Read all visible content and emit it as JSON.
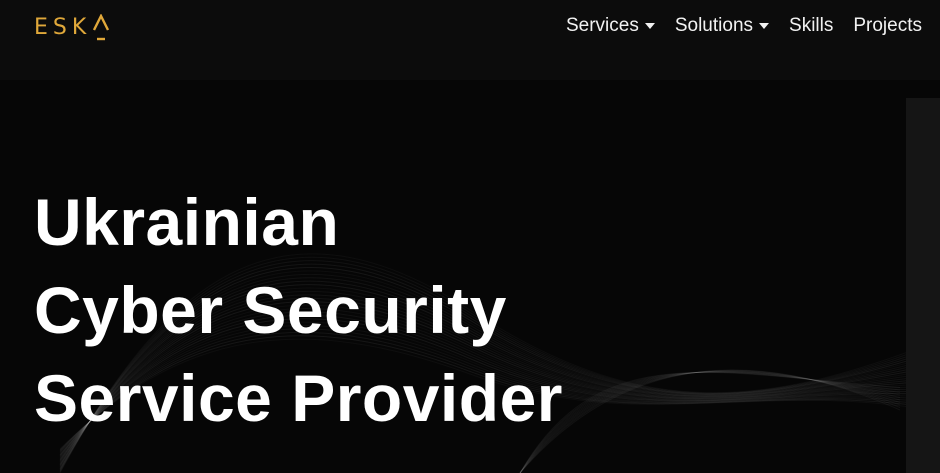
{
  "brand": {
    "logo_text": "ESK",
    "logo_mark": "A-chevron-underscore",
    "accent_color": "#e0a83a"
  },
  "nav": {
    "items": [
      {
        "label": "Services",
        "has_dropdown": true
      },
      {
        "label": "Solutions",
        "has_dropdown": true
      },
      {
        "label": "Skills",
        "has_dropdown": false
      },
      {
        "label": "Projects",
        "has_dropdown": false
      }
    ]
  },
  "hero": {
    "headline_lines": [
      "Ukrainian",
      "Cyber Security",
      "Service Provider"
    ],
    "background": "dark-wave-lines"
  }
}
